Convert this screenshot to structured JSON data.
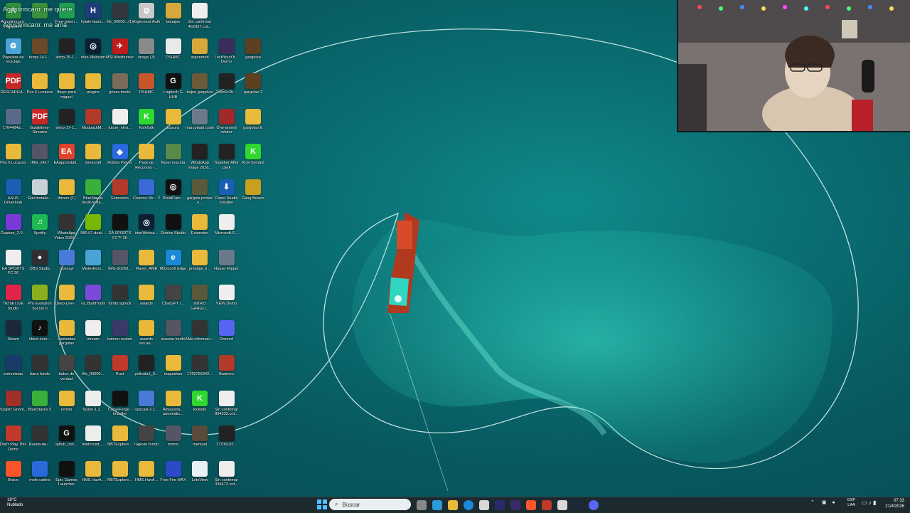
{
  "desktop": {
    "icons": [
      {
        "label": "Agustinncaro: me quiere",
        "color": "#2e8f3c",
        "glyph": "A"
      },
      {
        "label": "",
        "color": "#3c8f3c",
        "glyph": ""
      },
      {
        "label": "Free-green...",
        "color": "#1f9e52",
        "glyph": ""
      },
      {
        "label": "hytale-launc...",
        "color": "#1f3c7a",
        "glyph": "H"
      },
      {
        "label": "file_00000...(1)",
        "color": "#33373d",
        "glyph": ""
      },
      {
        "label": "Argenmod Auth",
        "color": "#c8c8c8",
        "glyph": "⚙"
      },
      {
        "label": "tatuajes",
        "color": "#d6a93a",
        "glyph": ""
      },
      {
        "label": "Sin confirmar 462937.crd...",
        "color": "#eeeeee",
        "glyph": ""
      },
      {
        "label": "Papelera de reciclaje",
        "color": "#4aa3d6",
        "glyph": "♻"
      },
      {
        "label": "temp-14-1...",
        "color": "#6a4a2a",
        "glyph": ""
      },
      {
        "label": "temp-15-1...",
        "color": "#222",
        "glyph": ""
      },
      {
        "label": "iriun Webcam",
        "color": "#0d1f33",
        "glyph": "◎"
      },
      {
        "label": "MSI Afterburner",
        "color": "#c21b1b",
        "glyph": "✈"
      },
      {
        "label": "image (3)",
        "color": "#8a8a8a",
        "glyph": ""
      },
      {
        "label": "DSHMC",
        "color": "#e9e9e9",
        "glyph": ""
      },
      {
        "label": "argenmod",
        "color": "#d6a93a",
        "glyph": ""
      },
      {
        "label": "LockYourOr... Demo",
        "color": "#3a2d5c",
        "glyph": ""
      },
      {
        "label": "gargolao",
        "color": "#5c4020",
        "glyph": ""
      },
      {
        "label": "DESCARGA...",
        "color": "#c62828",
        "glyph": "PDF"
      },
      {
        "label": "Pes 6 Locazos",
        "color": "#e8b93a",
        "glyph": ""
      },
      {
        "label": "flayer para miguel",
        "color": "#e8b93a",
        "glyph": ""
      },
      {
        "label": "plugins",
        "color": "#e8b93a",
        "glyph": ""
      },
      {
        "label": "grizas fondo",
        "color": "#7a6a5a",
        "glyph": ""
      },
      {
        "label": "DSHMC",
        "color": "#c8562a",
        "glyph": ""
      },
      {
        "label": "Logitech G HUB",
        "color": "#111",
        "glyph": "G"
      },
      {
        "label": "bajeo gargolao",
        "color": "#6a5a3a",
        "glyph": ""
      },
      {
        "label": "34ec5c2b...",
        "color": "#222",
        "glyph": ""
      },
      {
        "label": "gargolao 2",
        "color": "#5c4020",
        "glyph": ""
      },
      {
        "label": "1764484d...",
        "color": "#5a6a8a",
        "glyph": ""
      },
      {
        "label": "Guidelines-Streams",
        "color": "#c62828",
        "glyph": "PDF"
      },
      {
        "label": "temp-17-1...",
        "color": "#222",
        "glyph": ""
      },
      {
        "label": "ModpackM...",
        "color": "#b33a2a",
        "glyph": ""
      },
      {
        "label": "future_elim...",
        "color": "#eeeeee",
        "glyph": ""
      },
      {
        "label": "KickTalk",
        "color": "#2fd82f",
        "glyph": "K"
      },
      {
        "label": "basura",
        "color": "#e8b93a",
        "glyph": ""
      },
      {
        "label": "marcobaid code",
        "color": "#6a7a8a",
        "glyph": ""
      },
      {
        "label": "One-armed robber",
        "color": "#a02a2a",
        "glyph": ""
      },
      {
        "label": "gargolao fc",
        "color": "#e8b93a",
        "glyph": ""
      },
      {
        "label": "Pes 6 Locazos",
        "color": "#e8b93a",
        "glyph": ""
      },
      {
        "label": "IMG_2417",
        "color": "#556",
        "glyph": ""
      },
      {
        "label": "EAappInstall...",
        "color": "#e0432a",
        "glyph": "EA"
      },
      {
        "label": "minecraft",
        "color": "#e8b93a",
        "glyph": ""
      },
      {
        "label": "Roblox Player",
        "color": "#2a6ae0",
        "glyph": "◆"
      },
      {
        "label": "Pack de Recursos -...",
        "color": "#e8b93a",
        "glyph": ""
      },
      {
        "label": "flayer maceta",
        "color": "#5a8a4a",
        "glyph": ""
      },
      {
        "label": "WhatsApp Image 2026...",
        "color": "#222",
        "glyph": ""
      },
      {
        "label": "Together After Dark",
        "color": "#222",
        "glyph": ""
      },
      {
        "label": "Kick-Symbol",
        "color": "#2fd82f",
        "glyph": "K"
      },
      {
        "label": "ASUS DriverHub",
        "color": "#1a5fb4",
        "glyph": ""
      },
      {
        "label": "EpicInstalle...",
        "color": "#c8d0d8",
        "glyph": ""
      },
      {
        "label": "drivers (1)",
        "color": "#e8b93a",
        "glyph": ""
      },
      {
        "label": "BlueStacks Multi-Insta...",
        "color": "#3ab03a",
        "glyph": ""
      },
      {
        "label": "Extension",
        "color": "#b33a2a",
        "glyph": ""
      },
      {
        "label": "Counter-Str... 2",
        "color": "#3a6ad8",
        "glyph": ""
      },
      {
        "label": "DroidCam...",
        "color": "#111",
        "glyph": "◎"
      },
      {
        "label": "gargola primer e...",
        "color": "#5a5a3a",
        "glyph": ""
      },
      {
        "label": "Camo Studio Installer",
        "color": "#1a5fb4",
        "glyph": "⬇"
      },
      {
        "label": "Gang Beasts",
        "color": "#c8a020",
        "glyph": ""
      },
      {
        "label": "Capture_2.0...",
        "color": "#7a3ad8",
        "glyph": ""
      },
      {
        "label": "Spotify",
        "color": "#1db954",
        "glyph": "♫"
      },
      {
        "label": "WhatsApp Video 2025-...",
        "color": "#333",
        "glyph": ""
      },
      {
        "label": "580.97-desk...",
        "color": "#76b900",
        "glyph": ""
      },
      {
        "label": "EA SPORTS FC™ 26",
        "color": "#111",
        "glyph": ""
      },
      {
        "label": "iriunWebca...",
        "color": "#0d1f33",
        "glyph": "◎"
      },
      {
        "label": "Roblox Studio",
        "color": "#111",
        "glyph": ""
      },
      {
        "label": "Extension",
        "color": "#e8b93a",
        "glyph": ""
      },
      {
        "label": "Microsoft.S...",
        "color": "#eeeeee",
        "glyph": ""
      },
      {
        "label": "EA SPORTS FC 26",
        "color": "#eeeeee",
        "glyph": ""
      },
      {
        "label": "OBS Studio",
        "color": "#302e31",
        "glyph": "●"
      },
      {
        "label": "Upscayl",
        "color": "#4a7ad8",
        "glyph": ""
      },
      {
        "label": "MisterHors...",
        "color": "#4aa3d6",
        "glyph": ""
      },
      {
        "label": "IMG-20260...",
        "color": "#556",
        "glyph": ""
      },
      {
        "label": "Flayer_AME",
        "color": "#e8b93a",
        "glyph": ""
      },
      {
        "label": "Microsoft Edge",
        "color": "#1a8ad8",
        "glyph": "e"
      },
      {
        "label": "prestige_ii...",
        "color": "#e8b93a",
        "glyph": ""
      },
      {
        "label": "House Flipper",
        "color": "#6a7a8a",
        "glyph": ""
      },
      {
        "label": "TikTok LIVE Studio",
        "color": "#e0244a",
        "glyph": ""
      },
      {
        "label": "Pro Evolution Soccer 6",
        "color": "#8ab020",
        "glyph": ""
      },
      {
        "label": "Deep-Live-...",
        "color": "#e8b93a",
        "glyph": ""
      },
      {
        "label": "vs_BuildTools",
        "color": "#7a4ad8",
        "glyph": ""
      },
      {
        "label": "fondo agruck",
        "color": "#333",
        "glyph": ""
      },
      {
        "label": "awards",
        "color": "#e8b93a",
        "glyph": ""
      },
      {
        "label": "ChatGPT I...",
        "color": "#444",
        "glyph": ""
      },
      {
        "label": "INTRO GARGO...",
        "color": "#5a5a3a",
        "glyph": ""
      },
      {
        "label": "VEIN Demo",
        "color": "#eeeeee",
        "glyph": ""
      },
      {
        "label": "Steam",
        "color": "#1b2838",
        "glyph": ""
      },
      {
        "label": "tiktok-icon...",
        "color": "#111",
        "glyph": "♪"
      },
      {
        "label": "camisetas gargolas",
        "color": "#e8b93a",
        "glyph": ""
      },
      {
        "label": "stream",
        "color": "#eeeeee",
        "glyph": ""
      },
      {
        "label": "banner roobet",
        "color": "#3a3a6a",
        "glyph": ""
      },
      {
        "label": "awards sss.ae...",
        "color": "#e8b93a",
        "glyph": ""
      },
      {
        "label": "maceta fondo",
        "color": "#556",
        "glyph": ""
      },
      {
        "label": "Más informaci...",
        "color": "#333",
        "glyph": ""
      },
      {
        "label": "Discord",
        "color": "#5865f2",
        "glyph": ""
      },
      {
        "label": "entrevistas",
        "color": "#1a3a6a",
        "glyph": ""
      },
      {
        "label": "bana fondo",
        "color": "#333",
        "glyph": ""
      },
      {
        "label": "balon de verdad",
        "color": "#444",
        "glyph": ""
      },
      {
        "label": "file_00000...",
        "color": "#333",
        "glyph": ""
      },
      {
        "label": "Rust",
        "color": "#c0392b",
        "glyph": ""
      },
      {
        "label": "pelicula1_0...",
        "color": "#222",
        "glyph": ""
      },
      {
        "label": "mapashax",
        "color": "#e8b93a",
        "glyph": ""
      },
      {
        "label": "1769759342...",
        "color": "#333",
        "glyph": ""
      },
      {
        "label": "Banners",
        "color": "#b33a2a",
        "glyph": ""
      },
      {
        "label": "Burglin' Gnom...",
        "color": "#a0302a",
        "glyph": ""
      },
      {
        "label": "BlueStacks 5",
        "color": "#3ab03a",
        "glyph": ""
      },
      {
        "label": "remini",
        "color": "#e8b93a",
        "glyph": ""
      },
      {
        "label": "fusion-1.2...",
        "color": "#eeeeee",
        "glyph": ""
      },
      {
        "label": "CurseForge - Installer",
        "color": "#111",
        "glyph": ""
      },
      {
        "label": "upscayl-2.1...",
        "color": "#4a7ad8",
        "glyph": ""
      },
      {
        "label": "Almacena... automatic...",
        "color": "#e8b93a",
        "glyph": ""
      },
      {
        "label": "kicktalk",
        "color": "#2fd82f",
        "glyph": "K"
      },
      {
        "label": "Sin confirmar 894333.crd...",
        "color": "#eeeeee",
        "glyph": ""
      },
      {
        "label": "Don't Play This Demo",
        "color": "#c0392b",
        "glyph": ""
      },
      {
        "label": "Rueda-de-...",
        "color": "#333",
        "glyph": ""
      },
      {
        "label": "lghub_inst...",
        "color": "#111",
        "glyph": "G"
      },
      {
        "label": "reinforced_...",
        "color": "#eeeeee",
        "glyph": ""
      },
      {
        "label": "NBTExplore...",
        "color": "#e8b93a",
        "glyph": ""
      },
      {
        "label": "ragevio fondo",
        "color": "#444",
        "glyph": ""
      },
      {
        "label": "momo",
        "color": "#556",
        "glyph": ""
      },
      {
        "label": "memuel",
        "color": "#5a4a3a",
        "glyph": ""
      },
      {
        "label": "17705102...",
        "color": "#222",
        "glyph": ""
      },
      {
        "label": "Brave",
        "color": "#fb542b",
        "glyph": ""
      },
      {
        "label": "mofo cstitris",
        "color": "#2a6ad8",
        "glyph": ""
      },
      {
        "label": "Epic Games Launcher",
        "color": "#111",
        "glyph": ""
      },
      {
        "label": "HMS.HavA...",
        "color": "#e8b93a",
        "glyph": ""
      },
      {
        "label": "NBTExplore...",
        "color": "#e8b93a",
        "glyph": ""
      },
      {
        "label": "HMS.HavA...",
        "color": "#e8b93a",
        "glyph": ""
      },
      {
        "label": "Free Fire MAX",
        "color": "#2a4ac8",
        "glyph": ""
      },
      {
        "label": "LetsView",
        "color": "#e8f0f8",
        "glyph": ""
      },
      {
        "label": "Sin confirmar 336672.crd...",
        "color": "#eeeeee",
        "glyph": ""
      }
    ]
  },
  "stream_chat": {
    "line1": "Agustinncaro: me quiere",
    "line2": "Agustinncaro: me ama"
  },
  "taskbar": {
    "search_placeholder": "Buscar",
    "weather_temp": "18°C",
    "weather_desc": "Nublado",
    "lang": "ESP",
    "layout": "LAA",
    "time": "07:33",
    "date": "21/4/2026"
  },
  "colors": {
    "sea": "#0a6f74",
    "taskbar": "#1c2a2f",
    "net": "#5ff2d8"
  }
}
